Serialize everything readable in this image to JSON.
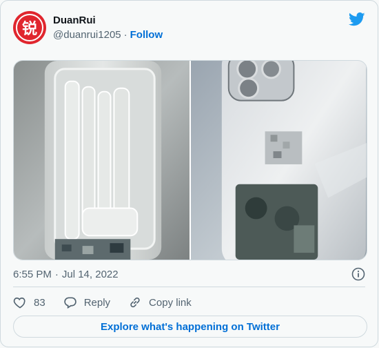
{
  "author": {
    "name": "DuanRui",
    "handle": "@duanrui1205",
    "separator": "·",
    "follow_label": "Follow",
    "avatar_glyph": "锐"
  },
  "media": {
    "photos": [
      "left-photo",
      "right-photo"
    ]
  },
  "meta": {
    "time": "6:55 PM",
    "separator": "·",
    "date": "Jul 14, 2022"
  },
  "actions": {
    "like_count": "83",
    "reply_label": "Reply",
    "copy_link_label": "Copy link"
  },
  "explore_label": "Explore what's happening on Twitter",
  "colors": {
    "accent": "#006fd6",
    "twitter_blue": "#1d9bf0",
    "avatar_red": "#e0262e",
    "muted": "#536471",
    "border": "#cfd9de"
  },
  "icons": [
    "twitter-bird-icon",
    "info-icon",
    "heart-icon",
    "reply-icon",
    "link-icon"
  ]
}
